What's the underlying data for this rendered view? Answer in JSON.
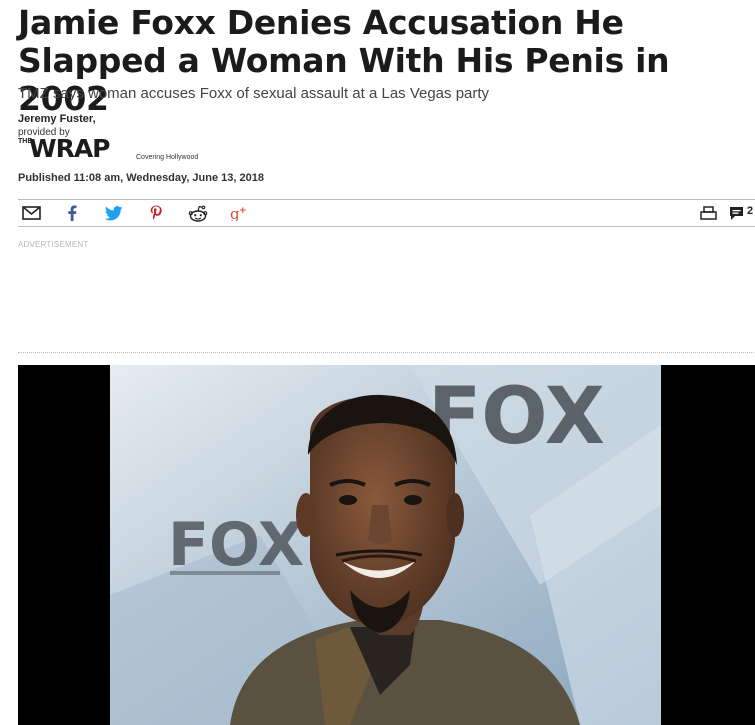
{
  "article": {
    "headline": "Jamie Foxx Denies Accusation He Slapped a Woman With His Penis in 2002",
    "subhead": "TMZ says woman accuses Foxx of sexual assault at a Las Vegas party",
    "author": "Jeremy Fuster,",
    "provided_by": "provided by",
    "source_logo": {
      "the": "THE",
      "name": "WRAP",
      "tagline": "Covering Hollywood"
    },
    "published": "Published 11:08 am, Wednesday, June 13, 2018"
  },
  "share_bar": {
    "icons": [
      "email-icon",
      "facebook-icon",
      "twitter-icon",
      "pinterest-icon",
      "reddit-icon",
      "googleplus-icon",
      "print-icon",
      "comment-icon"
    ],
    "comment_count": "2"
  },
  "ad": {
    "label": "ADVERTISEMENT"
  },
  "hero": {
    "backdrop_text": [
      "FOX",
      "FOX"
    ],
    "colors": {
      "backdrop": "#9fb7cc",
      "skin": "#6b4530",
      "jacket": "#5a5140"
    }
  }
}
